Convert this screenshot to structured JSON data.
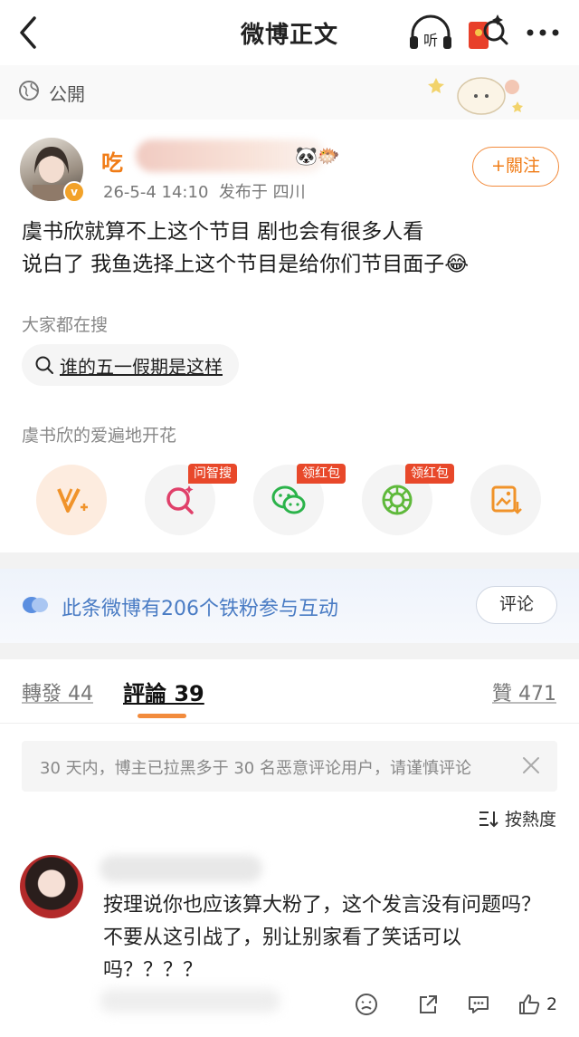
{
  "header": {
    "title": "微博正文",
    "listen_label": "听"
  },
  "visibility": {
    "label": "公開"
  },
  "author": {
    "name_prefix": "吃",
    "time": "26-5-4 14:10",
    "location_text": "发布于 四川",
    "emojis": "🐼🐡",
    "follow_label": "+關注"
  },
  "post": {
    "line1": "虞书欣就算不上这个节目 剧也会有很多人看",
    "line2": "说白了 我鱼选择上这个节目是给你们节目面子😂"
  },
  "trending": {
    "label": "大家都在搜",
    "query": "谁的五一假期是这样"
  },
  "flower": {
    "label": "虞书欣的爱遍地开花"
  },
  "share_tags": {
    "ask": "问智搜",
    "redpack1": "领红包",
    "redpack2": "领红包"
  },
  "fans_bar": {
    "text": "此条微博有206个铁粉参与互动",
    "button": "评论"
  },
  "tabs": {
    "repost": "轉發 44",
    "comments": "評論 39",
    "likes": "贊 471"
  },
  "notice": {
    "text": "30 天内，博主已拉黑多于 30 名恶意评论用户，请谨慎评论"
  },
  "sort": {
    "label": "按熱度"
  },
  "comment": {
    "text": "按理说你也应该算大粉了，这个发言没有问题吗？不要从这引战了，别让别家看了笑话可以吗？？？？",
    "likes": "2"
  },
  "colors": {
    "accent": "#f07c16",
    "link_blue": "#4a7cc4",
    "tag_red": "#e8482a"
  }
}
